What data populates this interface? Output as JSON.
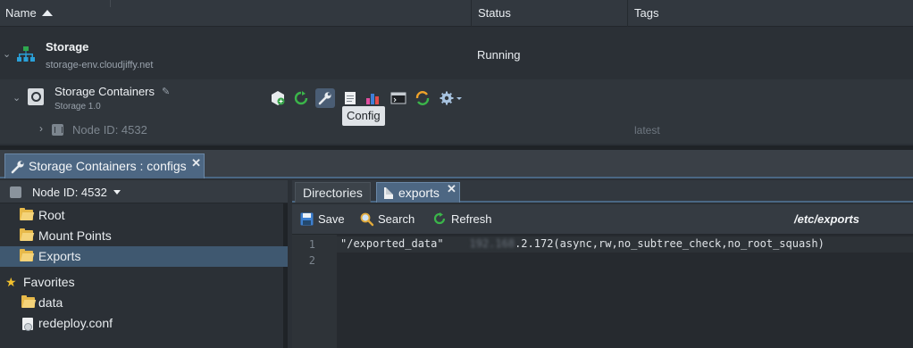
{
  "grid": {
    "columns": [
      "Name",
      "Status",
      "Tags"
    ],
    "environment": {
      "name": "Storage",
      "domain": "storage-env.cloudjiffy.net",
      "status": "Running"
    },
    "node_group": {
      "name": "Storage Containers",
      "version": "Storage 1.0",
      "tooltip": "Config",
      "tools": [
        "add-node-icon",
        "restart-icon",
        "config-icon",
        "log-icon",
        "statistics-icon",
        "web-ssh-icon",
        "redeploy-icon",
        "settings-icon"
      ]
    },
    "node": {
      "id_label": "Node ID: 4532",
      "tag": "latest"
    }
  },
  "panel": {
    "tab_title": "Storage Containers : configs",
    "node_selector": "Node ID: 4532",
    "tree": [
      {
        "label": "Root",
        "type": "folder"
      },
      {
        "label": "Mount Points",
        "type": "folder"
      },
      {
        "label": "Exports",
        "type": "folder",
        "selected": true
      }
    ],
    "favorites_label": "Favorites",
    "favorites": [
      {
        "label": "data",
        "type": "folder"
      },
      {
        "label": "redeploy.conf",
        "type": "file"
      }
    ],
    "editor_tabs": {
      "directories": "Directories",
      "file": "exports"
    },
    "toolbar": {
      "save": "Save",
      "search": "Search",
      "refresh": "Refresh",
      "path": "/etc/exports"
    },
    "editor": {
      "line_numbers": [
        "1",
        "2"
      ],
      "line1_prefix": "\"/exported_data\"    ",
      "line1_blurred": "192.168",
      "line1_suffix": ".2.172(async,rw,no_subtree_check,no_root_squash)"
    }
  },
  "colors": {
    "accent": "#4d6783",
    "selected_row": "#3f5870",
    "folder": "#e7b94a",
    "background": "#2b3036"
  }
}
